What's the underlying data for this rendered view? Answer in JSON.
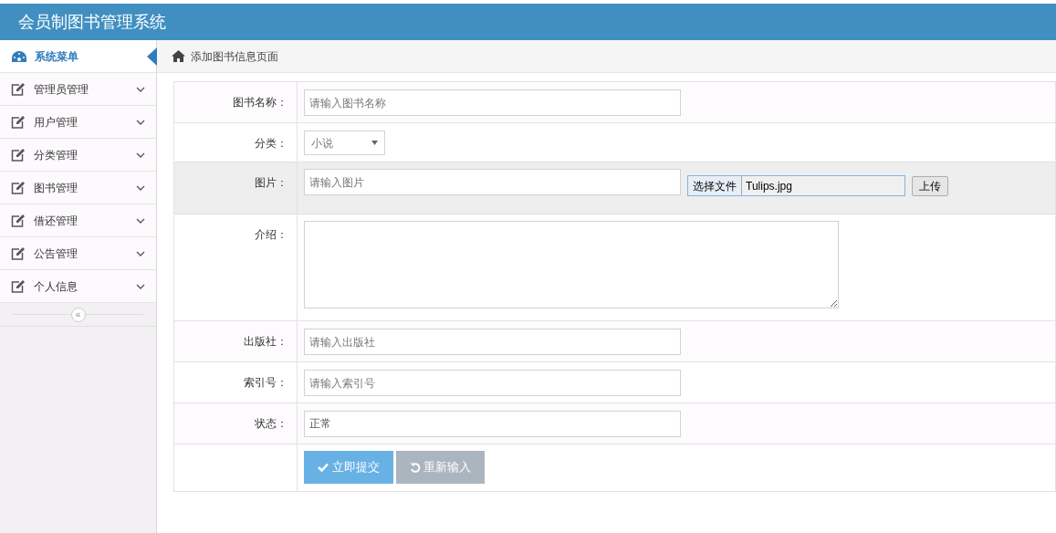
{
  "header": {
    "title": "会员制图书管理系统"
  },
  "sidebar": {
    "heading": "系统菜单",
    "items": [
      {
        "label": "管理员管理",
        "expanded": false
      },
      {
        "label": "用户管理",
        "expanded": false
      },
      {
        "label": "分类管理",
        "expanded": false
      },
      {
        "label": "图书管理",
        "expanded": false
      },
      {
        "label": "借还管理",
        "expanded": false
      },
      {
        "label": "公告管理",
        "expanded": false
      },
      {
        "label": "个人信息",
        "expanded": false
      }
    ],
    "collapse": "«"
  },
  "breadcrumb": "添加图书信息页面",
  "form": {
    "rows": [
      {
        "kind": "text",
        "label": "图书名称：",
        "placeholder": "请输入图书名称",
        "highlighted": false
      },
      {
        "kind": "select",
        "label": "分类：",
        "value": "小说",
        "highlighted": false
      },
      {
        "kind": "file",
        "label": "图片：",
        "placeholder": "请输入图片",
        "file_button": "选择文件",
        "file_name": "Tulips.jpg",
        "upload_button": "上传",
        "highlighted": true
      },
      {
        "kind": "textarea",
        "label": "介绍：",
        "highlighted": false
      },
      {
        "kind": "text",
        "label": "出版社：",
        "placeholder": "请输入出版社",
        "highlighted": false
      },
      {
        "kind": "text",
        "label": "索引号：",
        "placeholder": "请输入索引号",
        "highlighted": false
      },
      {
        "kind": "text",
        "label": "状态：",
        "value": "正常",
        "highlighted": false
      },
      {
        "kind": "buttons",
        "submit": "立即提交",
        "reset": "重新输入",
        "highlighted": false
      }
    ]
  }
}
